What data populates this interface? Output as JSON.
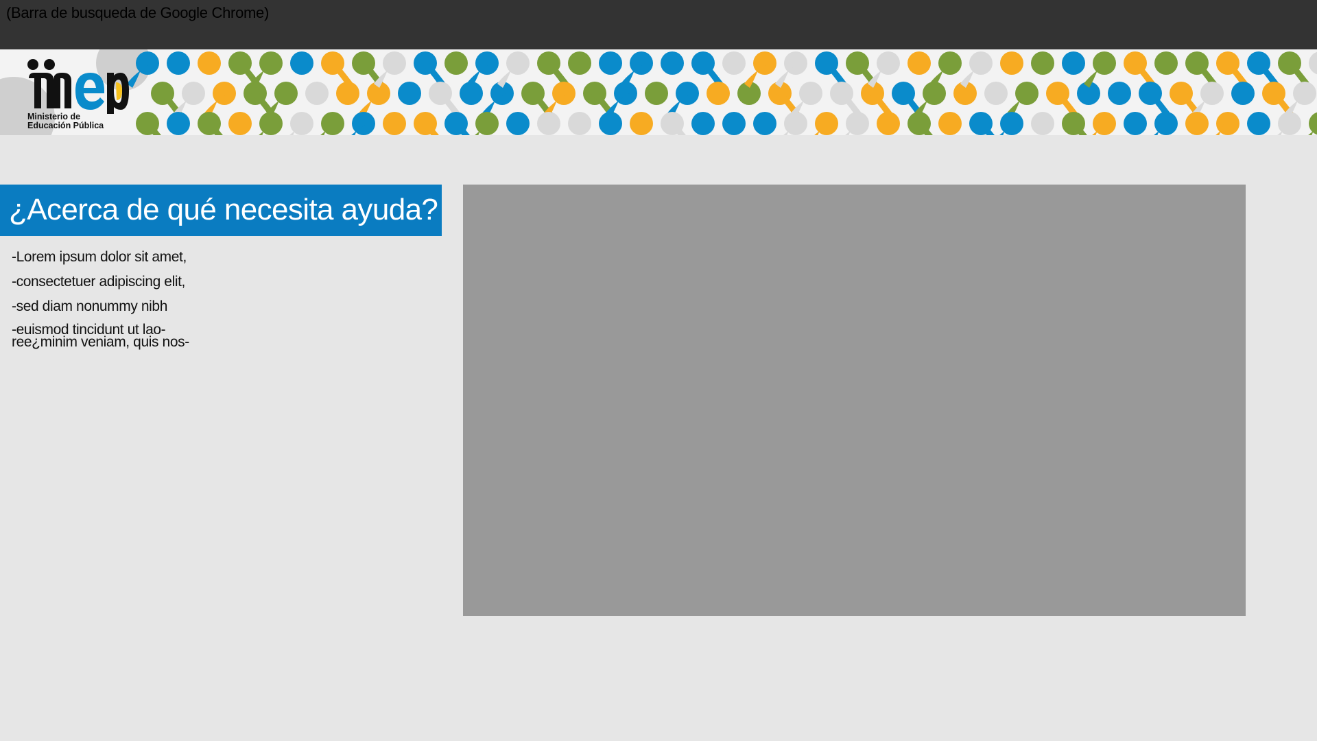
{
  "browser": {
    "bar_label": "(Barra de busqueda de Google Chrome)"
  },
  "banner": {
    "logo": {
      "wordmark": "mep",
      "subtitle_line1": "Ministerio de",
      "subtitle_line2": "Educación Pública"
    },
    "pattern_colors": [
      "#7a9e3a",
      "#0a8bcb",
      "#f7ab22",
      "#d9d9d9"
    ]
  },
  "help": {
    "title": "¿Acerca de qué necesita ayuda?",
    "items": [
      "-Lorem ipsum dolor sit amet,",
      "-consectetuer adipiscing elit,",
      "-sed diam nonummy nibh",
      "-euismod tincidunt ut lao­ree¿minim veniam, quis nos-"
    ]
  },
  "colors": {
    "accent": "#0a7cc1",
    "background": "#e6e6e6",
    "top_bar": "#333333",
    "media_placeholder": "#999999"
  }
}
